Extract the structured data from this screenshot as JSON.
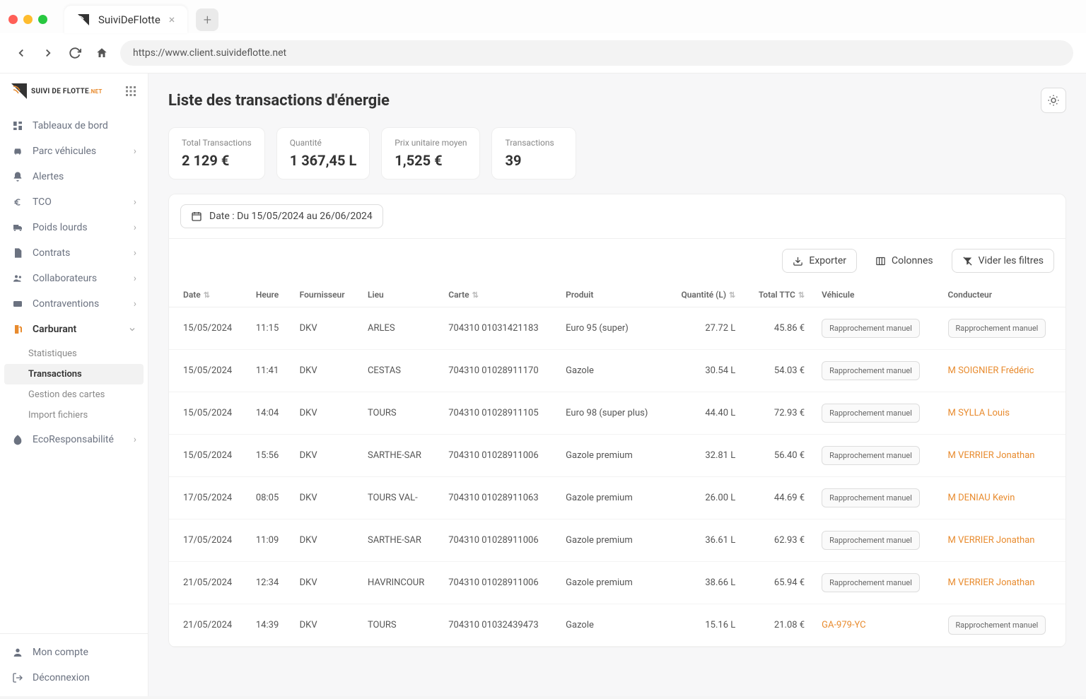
{
  "browser": {
    "tab_title": "SuiviDeFlotte",
    "url": "https://www.client.suivideflotte.net"
  },
  "brand": {
    "name": "SUIVI DE FLOTTE",
    "suffix": ".NET"
  },
  "sidebar": {
    "items": [
      {
        "label": "Tableaux de bord",
        "expandable": false
      },
      {
        "label": "Parc véhicules",
        "expandable": true
      },
      {
        "label": "Alertes",
        "expandable": false
      },
      {
        "label": "TCO",
        "expandable": true
      },
      {
        "label": "Poids lourds",
        "expandable": true
      },
      {
        "label": "Contrats",
        "expandable": true
      },
      {
        "label": "Collaborateurs",
        "expandable": true
      },
      {
        "label": "Contraventions",
        "expandable": true
      },
      {
        "label": "Carburant",
        "expandable": true
      },
      {
        "label": "EcoResponsabilité",
        "expandable": true
      }
    ],
    "carburant_sub": [
      "Statistiques",
      "Transactions",
      "Gestion des cartes",
      "Import fichiers"
    ],
    "footer": {
      "account": "Mon compte",
      "logout": "Déconnexion"
    }
  },
  "page": {
    "title": "Liste des transactions d'énergie"
  },
  "stats": [
    {
      "label": "Total Transactions",
      "value": "2 129 €"
    },
    {
      "label": "Quantité",
      "value": "1 367,45 L"
    },
    {
      "label": "Prix unitaire moyen",
      "value": "1,525 €"
    },
    {
      "label": "Transactions",
      "value": "39"
    }
  ],
  "filters": {
    "date_label": "Date : Du 15/05/2024 au 26/06/2024"
  },
  "actions": {
    "export": "Exporter",
    "columns": "Colonnes",
    "clear_filters": "Vider les filtres"
  },
  "table": {
    "headers": {
      "date": "Date",
      "heure": "Heure",
      "fournisseur": "Fournisseur",
      "lieu": "Lieu",
      "carte": "Carte",
      "produit": "Produit",
      "quantite": "Quantité (L)",
      "total_ttc": "Total TTC",
      "vehicule": "Véhicule",
      "conducteur": "Conducteur"
    },
    "manual_label": "Rapprochement manuel",
    "rows": [
      {
        "date": "15/05/2024",
        "heure": "11:15",
        "fournisseur": "DKV",
        "lieu": "ARLES",
        "carte": "704310 01031421183",
        "produit": "Euro 95 (super)",
        "quantite": "27.72 L",
        "total": "45.86 €",
        "vehicule": null,
        "conducteur": null
      },
      {
        "date": "15/05/2024",
        "heure": "11:41",
        "fournisseur": "DKV",
        "lieu": "CESTAS",
        "carte": "704310 01028911170",
        "produit": "Gazole",
        "quantite": "30.54 L",
        "total": "54.03 €",
        "vehicule": null,
        "conducteur": "M SOIGNIER Frédéric"
      },
      {
        "date": "15/05/2024",
        "heure": "14:04",
        "fournisseur": "DKV",
        "lieu": "TOURS",
        "carte": "704310 01028911105",
        "produit": "Euro 98 (super plus)",
        "quantite": "44.40 L",
        "total": "72.93 €",
        "vehicule": null,
        "conducteur": "M SYLLA Louis"
      },
      {
        "date": "15/05/2024",
        "heure": "15:56",
        "fournisseur": "DKV",
        "lieu": "SARTHE-SAR",
        "carte": "704310 01028911006",
        "produit": "Gazole premium",
        "quantite": "32.81 L",
        "total": "56.40 €",
        "vehicule": null,
        "conducteur": "M VERRIER Jonathan"
      },
      {
        "date": "17/05/2024",
        "heure": "08:05",
        "fournisseur": "DKV",
        "lieu": "TOURS VAL-",
        "carte": "704310 01028911063",
        "produit": "Gazole premium",
        "quantite": "26.00 L",
        "total": "44.69 €",
        "vehicule": null,
        "conducteur": "M DENIAU Kevin"
      },
      {
        "date": "17/05/2024",
        "heure": "11:09",
        "fournisseur": "DKV",
        "lieu": "SARTHE-SAR",
        "carte": "704310 01028911006",
        "produit": "Gazole premium",
        "quantite": "36.61 L",
        "total": "62.93 €",
        "vehicule": null,
        "conducteur": "M VERRIER Jonathan"
      },
      {
        "date": "21/05/2024",
        "heure": "12:34",
        "fournisseur": "DKV",
        "lieu": "HAVRINCOUR",
        "carte": "704310 01028911006",
        "produit": "Gazole premium",
        "quantite": "38.66 L",
        "total": "65.94 €",
        "vehicule": null,
        "conducteur": "M VERRIER Jonathan"
      },
      {
        "date": "21/05/2024",
        "heure": "14:39",
        "fournisseur": "DKV",
        "lieu": "TOURS",
        "carte": "704310 01032439473",
        "produit": "Gazole",
        "quantite": "15.16 L",
        "total": "21.08 €",
        "vehicule": "GA-979-YC",
        "conducteur": null
      }
    ]
  }
}
